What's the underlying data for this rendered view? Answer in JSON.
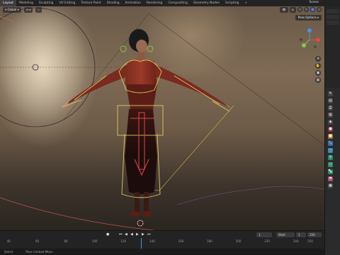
{
  "workspaces": [
    {
      "label": "Layout",
      "active": true
    },
    {
      "label": "Modeling",
      "active": false
    },
    {
      "label": "Sculpting",
      "active": false
    },
    {
      "label": "UV Editing",
      "active": false
    },
    {
      "label": "Texture Paint",
      "active": false
    },
    {
      "label": "Shading",
      "active": false
    },
    {
      "label": "Animation",
      "active": false
    },
    {
      "label": "Rendering",
      "active": false
    },
    {
      "label": "Compositing",
      "active": false
    },
    {
      "label": "Geometry Nodes",
      "active": false
    },
    {
      "label": "Scripting",
      "active": false
    },
    {
      "label": "+",
      "active": false
    }
  ],
  "scene": {
    "label": "Scene"
  },
  "viewport": {
    "orientation_label": "Global",
    "pose_options_label": "Pose Options"
  },
  "timeline": {
    "current_frame": "1",
    "start_label": "Start",
    "start_value": "1",
    "end_label": "End",
    "end_value": "250",
    "ticks": [
      "40",
      "60",
      "80",
      "100",
      "120",
      "140",
      "160",
      "180",
      "200",
      "220",
      "240",
      "250"
    ]
  },
  "statusbar": {
    "items": [
      "Select",
      "Pose Context Menu"
    ]
  },
  "colors": {
    "accent": "#4a7fd6",
    "armature": "#e0c85a",
    "gizmo_x": "#e0474c",
    "gizmo_y": "#8bc34a",
    "gizmo_z": "#4a90e2"
  }
}
